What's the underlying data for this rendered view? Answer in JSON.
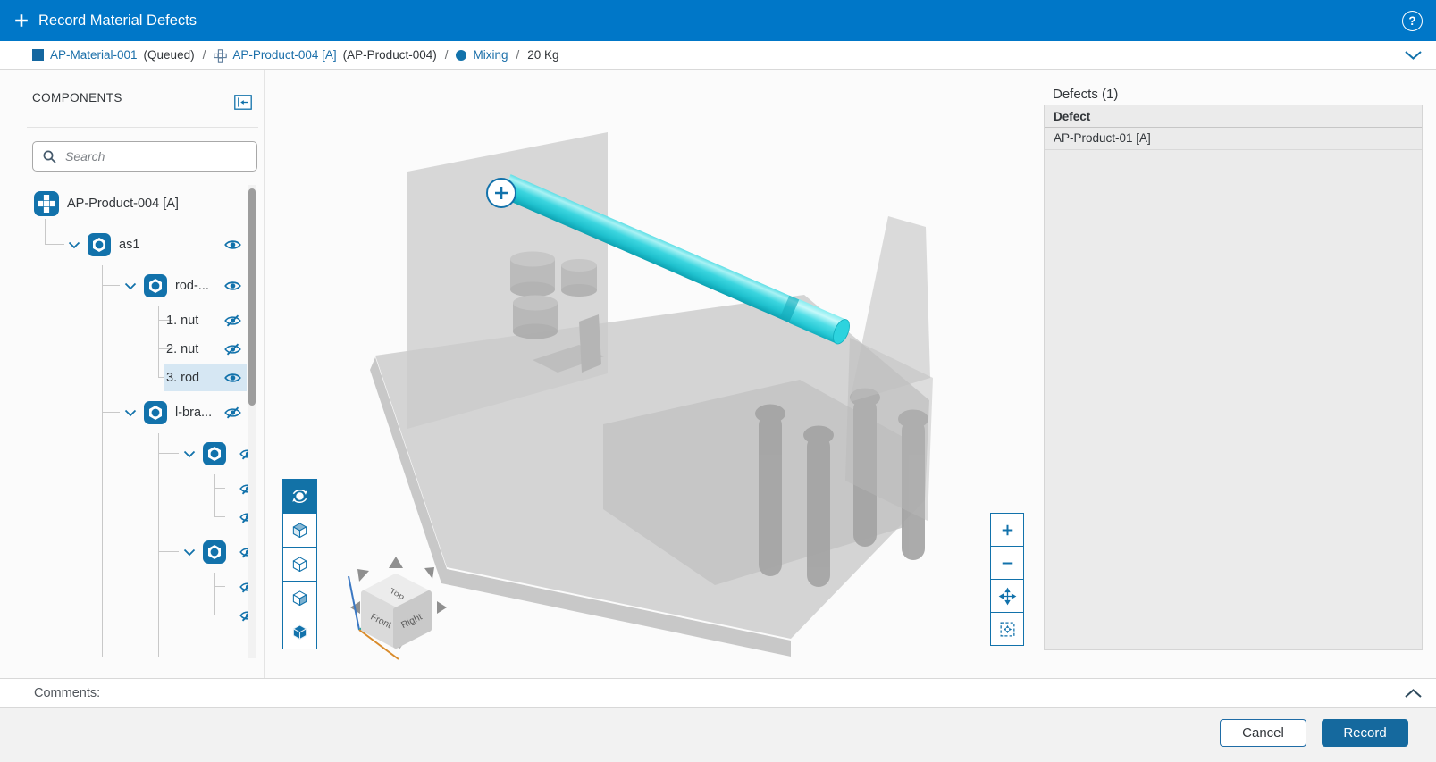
{
  "header": {
    "title": "Record Material Defects",
    "help_glyph": "?"
  },
  "breadcrumb": {
    "material_label": "AP-Material-001",
    "material_status": "(Queued)",
    "separator": "/",
    "product_label": "AP-Product-004 [A]",
    "product_alt": "(AP-Product-004)",
    "operation_label": "Mixing",
    "quantity": "20 Kg"
  },
  "components": {
    "title": "COMPONENTS",
    "search_placeholder": "Search",
    "tree": [
      {
        "label": "AP-Product-004 [A]",
        "icon": "product",
        "level": 0,
        "eye": "none",
        "chevron": false,
        "selected": false,
        "clipped": false
      },
      {
        "label": "as1",
        "icon": "assembly",
        "level": 1,
        "eye": "visible",
        "chevron": true,
        "selected": false,
        "clipped": false
      },
      {
        "label": "rod-...",
        "icon": "assembly",
        "level": 2,
        "eye": "visible",
        "chevron": true,
        "selected": false,
        "clipped": false
      },
      {
        "label": "1. nut",
        "icon": "none",
        "level": 3,
        "eye": "hidden",
        "chevron": false,
        "selected": false,
        "clipped": false
      },
      {
        "label": "2. nut",
        "icon": "none",
        "level": 3,
        "eye": "hidden",
        "chevron": false,
        "selected": false,
        "clipped": false
      },
      {
        "label": "3. rod",
        "icon": "none",
        "level": 3,
        "eye": "visible",
        "chevron": false,
        "selected": true,
        "clipped": false
      },
      {
        "label": "l-bra...",
        "icon": "assembly",
        "level": 2,
        "eye": "hidden",
        "chevron": true,
        "selected": false,
        "clipped": false
      },
      {
        "label": "",
        "icon": "assembly",
        "level": 3,
        "eye": "hidden",
        "chevron": true,
        "selected": false,
        "clipped": true
      },
      {
        "label": "",
        "icon": "none",
        "level": 4,
        "eye": "hidden",
        "chevron": false,
        "selected": false,
        "clipped": true
      },
      {
        "label": "",
        "icon": "none",
        "level": 4,
        "eye": "hidden",
        "chevron": false,
        "selected": false,
        "clipped": true
      },
      {
        "label": "",
        "icon": "assembly",
        "level": 3,
        "eye": "hidden",
        "chevron": true,
        "selected": false,
        "clipped": true
      },
      {
        "label": "",
        "icon": "none",
        "level": 4,
        "eye": "hidden",
        "chevron": false,
        "selected": false,
        "clipped": true
      },
      {
        "label": "",
        "icon": "none",
        "level": 4,
        "eye": "hidden",
        "chevron": false,
        "selected": false,
        "clipped": true
      }
    ]
  },
  "viewer": {
    "tools": [
      {
        "name": "orbit-tool",
        "selected": true
      },
      {
        "name": "view-cube-shaded",
        "selected": false
      },
      {
        "name": "view-cube-wireframe",
        "selected": false
      },
      {
        "name": "view-cube-face",
        "selected": false
      },
      {
        "name": "view-cube-solid",
        "selected": false
      }
    ],
    "zoom_controls": [
      {
        "name": "zoom-in"
      },
      {
        "name": "zoom-out"
      },
      {
        "name": "pan"
      },
      {
        "name": "fit-to-view"
      }
    ],
    "view_cube": {
      "top": "Top",
      "front": "Front",
      "right": "Right"
    }
  },
  "defects": {
    "title": "Defects (1)",
    "column": "Defect",
    "rows": [
      {
        "name": "AP-Product-01 [A]"
      }
    ]
  },
  "comments": {
    "label": "Comments:"
  },
  "footer": {
    "cancel_label": "Cancel",
    "record_label": "Record"
  },
  "colors": {
    "header_bar": "#0077c8",
    "accent": "#1272ab",
    "button": "#15699e",
    "link": "#1b6fa9",
    "selection": "#d6e7f3",
    "rod": "#2fd2dc"
  }
}
